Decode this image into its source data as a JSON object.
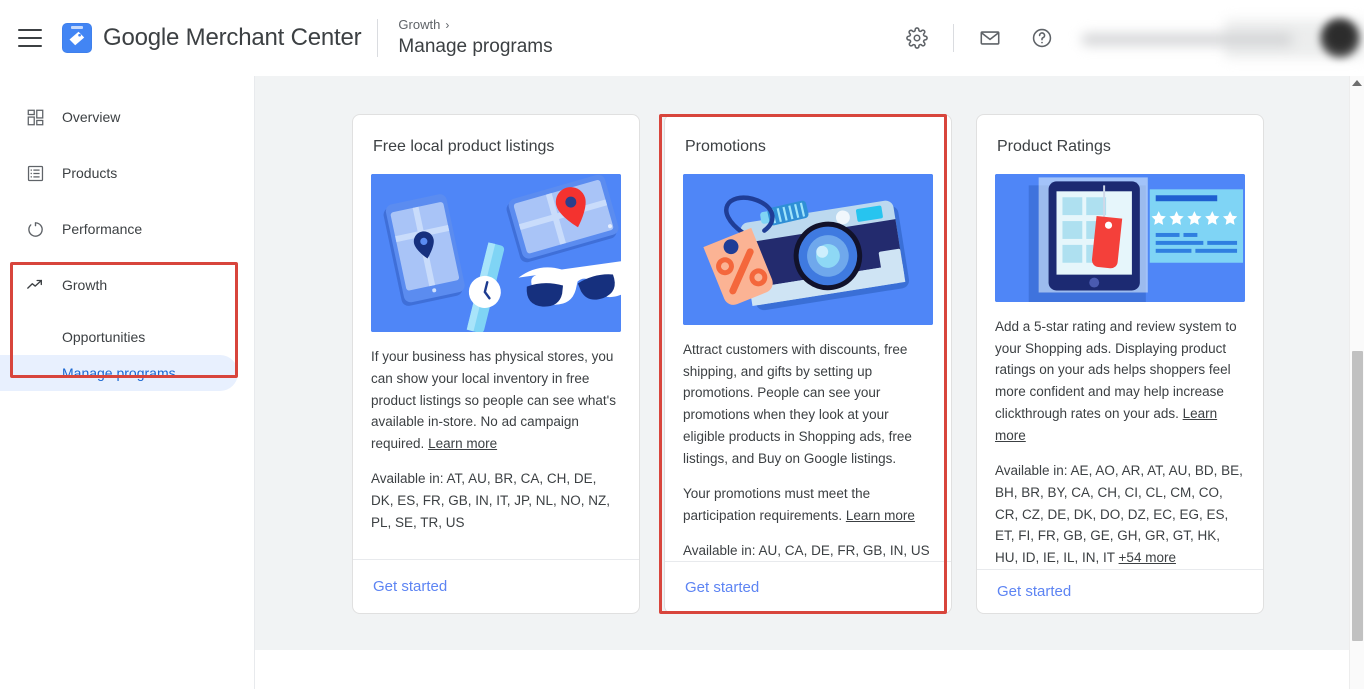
{
  "header": {
    "menu_icon": "hamburger-menu-icon",
    "logo_icon": "merchant-center-logo-icon",
    "brand_google": "Google",
    "brand_product": "Merchant Center",
    "breadcrumb_parent": "Growth",
    "breadcrumb_chevron": "›",
    "breadcrumb_current": "Manage programs",
    "settings_icon": "gear-icon",
    "mail_icon": "mail-icon",
    "help_icon": "help-circle-icon",
    "account_icon": "avatar"
  },
  "sidebar": {
    "items": [
      {
        "label": "Overview",
        "icon": "dashboard-grid-icon"
      },
      {
        "label": "Products",
        "icon": "catalog-list-icon"
      },
      {
        "label": "Performance",
        "icon": "performance-circle-icon"
      },
      {
        "label": "Growth",
        "icon": "trending-up-icon"
      }
    ],
    "sub_items": [
      {
        "label": "Opportunities",
        "selected": false
      },
      {
        "label": "Manage programs",
        "selected": true
      }
    ]
  },
  "main": {
    "cards": [
      {
        "title": "Free local product listings",
        "image": "local-product-listings-illustration",
        "paragraphs": [
          "If your business has physical stores, you can show your local inventory in free product listings so people can see what's available in-store. No ad campaign required.",
          "Available in: AT, AU, BR, CA, CH, DE, DK, ES, FR, GB, IN, IT, JP, NL, NO, NZ, PL, SE, TR, US"
        ],
        "link_label": "Learn more",
        "cta": "Get started",
        "highlighted": false
      },
      {
        "title": "Promotions",
        "image": "promotions-camera-discount-illustration",
        "paragraphs": [
          "Attract customers with discounts, free shipping, and gifts by setting up promotions. People can see your promotions when they look at your eligible products in Shopping ads, free listings, and Buy on Google listings.",
          "Your promotions must meet the participation requirements.",
          "Available in: AU, CA, DE, FR, GB, IN, US"
        ],
        "link_label": "Learn more",
        "cta": "Get started",
        "highlighted": true
      },
      {
        "title": "Product Ratings",
        "image": "product-ratings-tablet-stars-illustration",
        "paragraphs": [
          "Add a 5-star rating and review system to your Shopping ads. Displaying product ratings on your ads helps shoppers feel more confident and may help increase clickthrough rates on your ads.",
          "Available in: AE, AO, AR, AT, AU, BD, BE, BH, BR, BY, CA, CH, CI, CL, CM, CO, CR, CZ, DE, DK, DO, DZ, EC, EG, ES, ET, FI, FR, GB, GE, GH, GR, GT, HK, HU, ID, IE, IL, IN, IT"
        ],
        "link_label": "Learn more",
        "more_label": "+54 more",
        "cta": "Get started",
        "highlighted": false
      }
    ]
  },
  "annotations": {
    "color": "#d8453c",
    "sidebar_box": "growth-section-highlight",
    "card_box": "promotions-card-highlight"
  },
  "scrollbar": {
    "name": "vertical-scrollbar",
    "thumb_position_pct": 48
  }
}
